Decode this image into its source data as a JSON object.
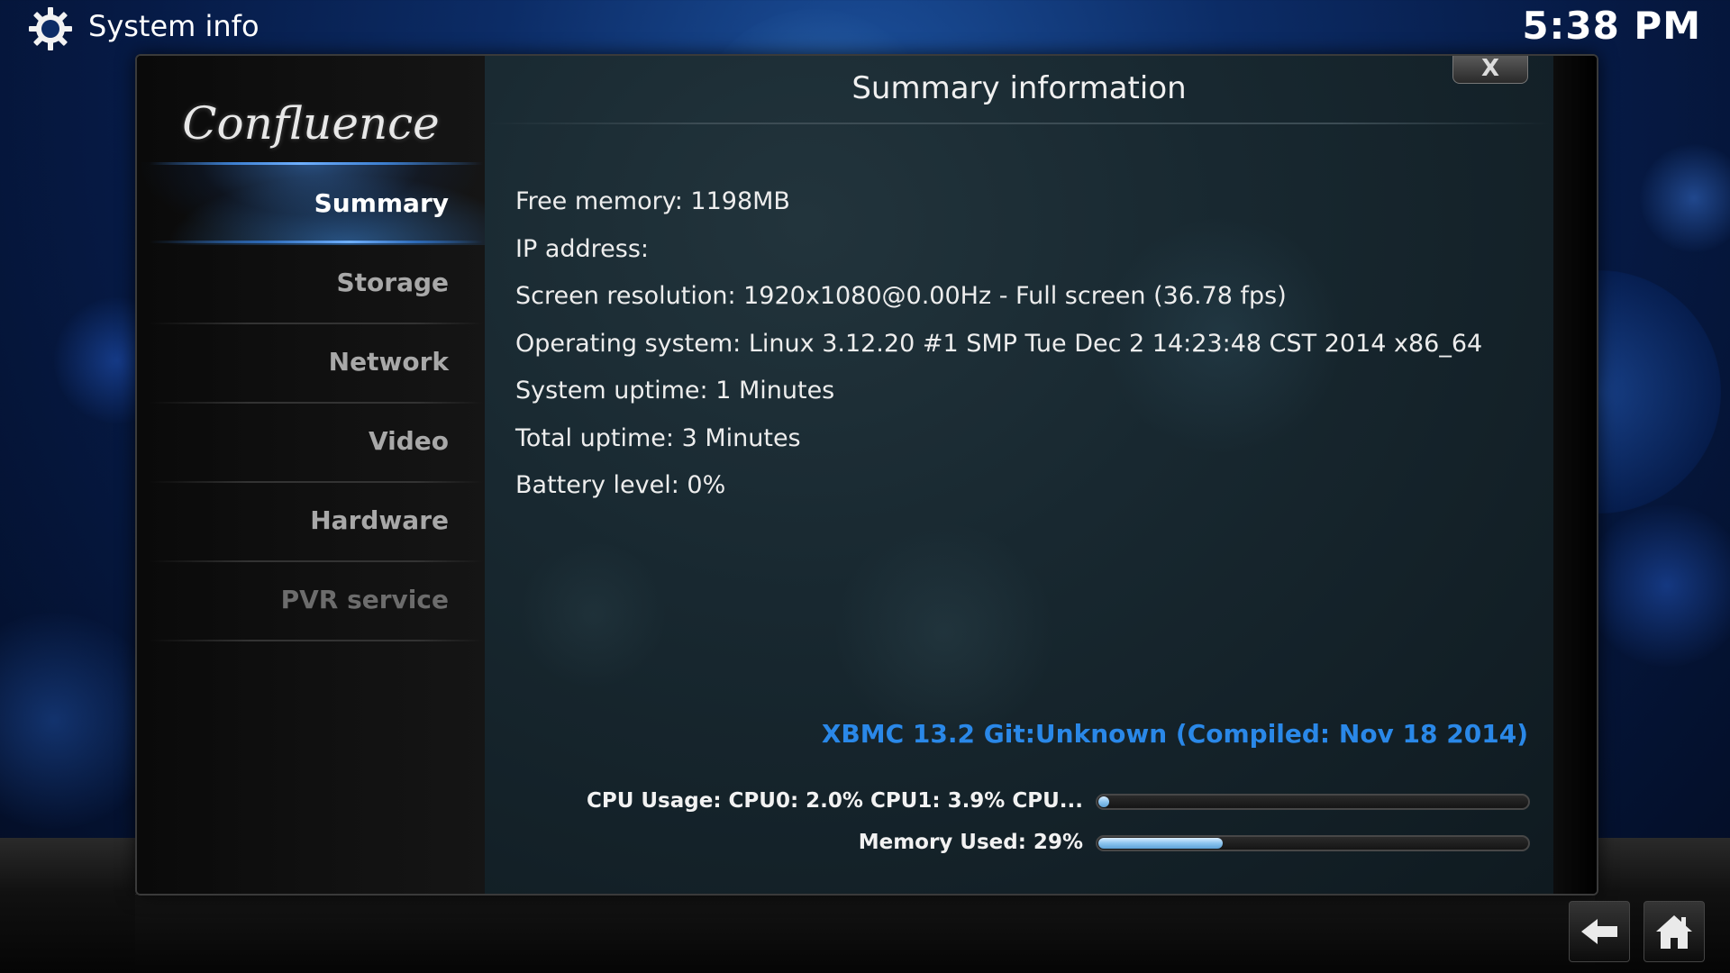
{
  "header": {
    "title": "System info",
    "clock": "5:38 PM",
    "icon": "gear-icon"
  },
  "sidebar": {
    "logo_text": "Confluence",
    "items": [
      {
        "label": "Summary",
        "state": "selected"
      },
      {
        "label": "Storage",
        "state": "normal"
      },
      {
        "label": "Network",
        "state": "normal"
      },
      {
        "label": "Video",
        "state": "normal"
      },
      {
        "label": "Hardware",
        "state": "normal"
      },
      {
        "label": "PVR service",
        "state": "disabled"
      }
    ]
  },
  "dialog": {
    "title": "Summary information",
    "close_label": "X"
  },
  "info": [
    "Free memory: 1198MB",
    "IP address:",
    "Screen resolution: 1920x1080@0.00Hz - Full screen (36.78 fps)",
    "Operating system: Linux 3.12.20 #1 SMP Tue Dec 2 14:23:48 CST 2014 x86_64",
    "System uptime: 1 Minutes",
    "Total uptime: 3 Minutes",
    "Battery level: 0%"
  ],
  "version": "XBMC 13.2 Git:Unknown (Compiled: Nov 18 2014)",
  "meters": {
    "cpu": {
      "label": "CPU Usage: CPU0: 2.0% CPU1: 3.9% CPU...",
      "percent": 2
    },
    "memory": {
      "label": "Memory Used: 29%",
      "percent": 29
    }
  },
  "footer": {
    "back_icon": "back-arrow-icon",
    "home_icon": "home-icon"
  },
  "colors": {
    "accent": "#2a88e8",
    "meter_fill": "#8cc4ee",
    "background": "#0c2c66"
  }
}
